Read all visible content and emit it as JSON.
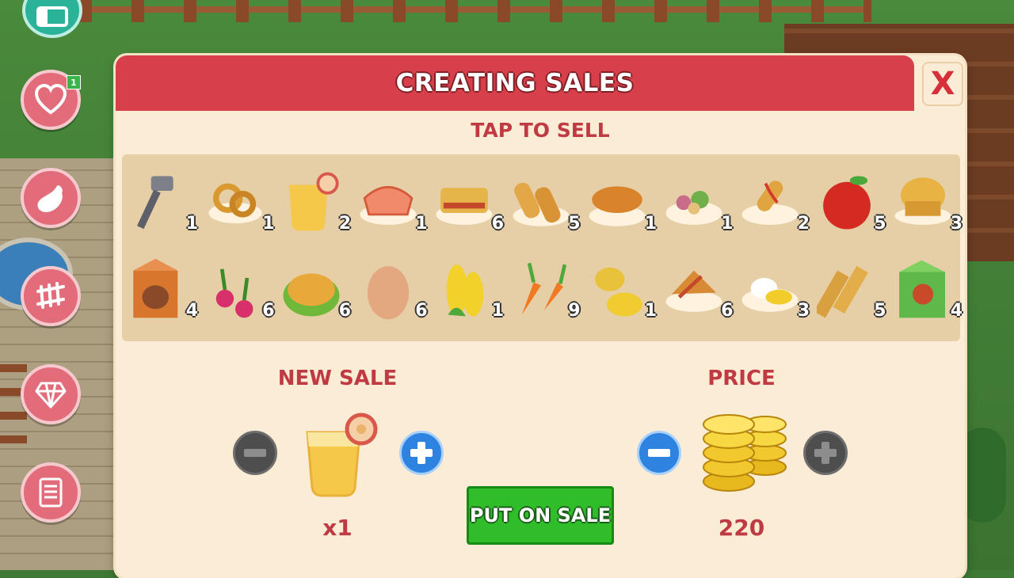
{
  "dialog": {
    "title": "CREATING SALES",
    "subtitle": "TAP TO SELL",
    "close_label": "X"
  },
  "sidebar": {
    "notification_badge": "1"
  },
  "inventory": {
    "rows": [
      [
        {
          "name": "hammer",
          "qty": "1"
        },
        {
          "name": "onion-rings",
          "qty": "1"
        },
        {
          "name": "apple-juice",
          "qty": "2"
        },
        {
          "name": "salmon-steak",
          "qty": "1"
        },
        {
          "name": "bacon-casserole",
          "qty": "6"
        },
        {
          "name": "spring-rolls",
          "qty": "5"
        },
        {
          "name": "roasted-corn",
          "qty": "1"
        },
        {
          "name": "salad",
          "qty": "1"
        },
        {
          "name": "corn-dog",
          "qty": "2"
        },
        {
          "name": "apple",
          "qty": "5"
        },
        {
          "name": "muffin",
          "qty": "3"
        }
      ],
      [
        {
          "name": "milk-carton",
          "qty": "4"
        },
        {
          "name": "radish",
          "qty": "6"
        },
        {
          "name": "pasta-bowl",
          "qty": "6"
        },
        {
          "name": "egg",
          "qty": "6"
        },
        {
          "name": "corn",
          "qty": "1"
        },
        {
          "name": "carrot",
          "qty": "9"
        },
        {
          "name": "lemon",
          "qty": "1"
        },
        {
          "name": "potato-wedges",
          "qty": "6"
        },
        {
          "name": "poached-egg",
          "qty": "3"
        },
        {
          "name": "wood-planks",
          "qty": "5"
        },
        {
          "name": "chicken-feed-box",
          "qty": "4"
        }
      ]
    ]
  },
  "new_sale": {
    "label": "NEW SALE",
    "item": "apple-juice",
    "quantity": "x1"
  },
  "price": {
    "label": "PRICE",
    "value": "220"
  },
  "put_on_sale_label": "PUT ON SALE",
  "colors": {
    "header": "#d73f4a",
    "panel": "#fbedd5",
    "grid": "#e6cfa6",
    "accent_text": "#c03a44",
    "sale_button": "#2fbe2a",
    "plus_blue": "#2f83e0"
  }
}
